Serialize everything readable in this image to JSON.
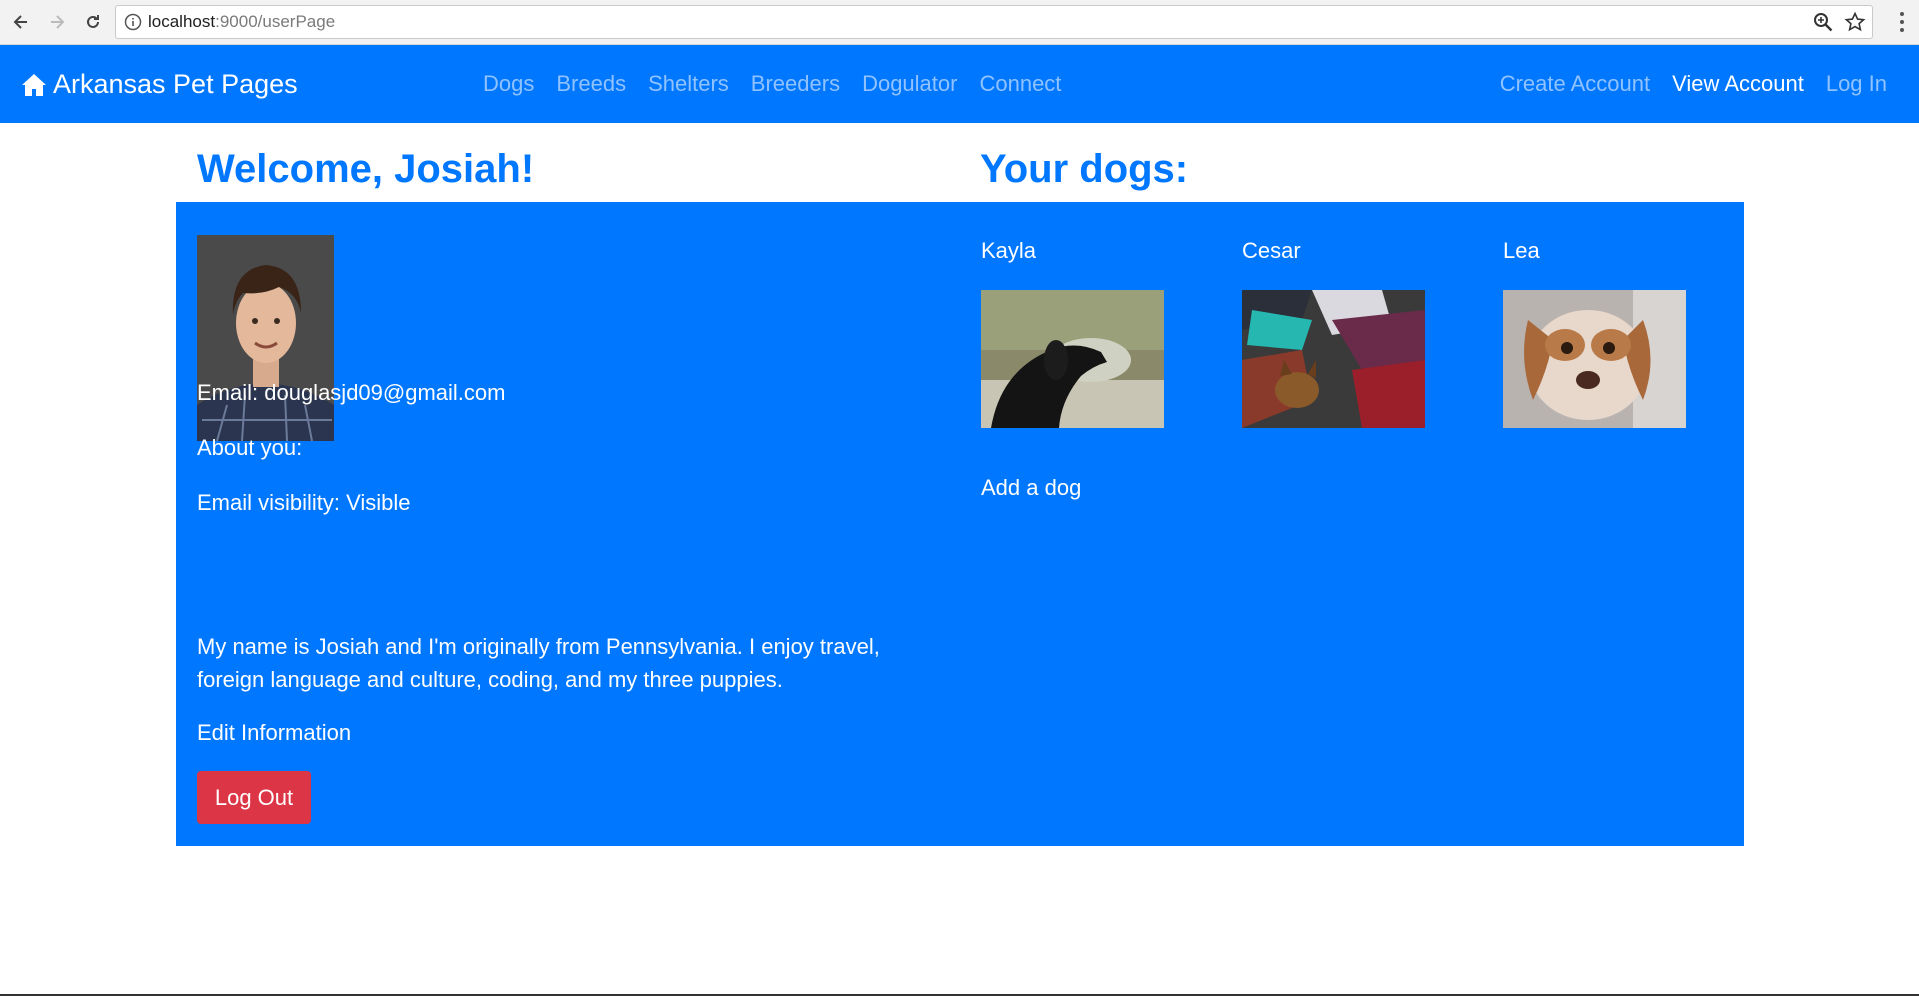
{
  "browser": {
    "url_host": "localhost",
    "url_path": ":9000/userPage"
  },
  "navbar": {
    "brand": "Arkansas Pet Pages",
    "links": [
      "Dogs",
      "Breeds",
      "Shelters",
      "Breeders",
      "Dogulator",
      "Connect"
    ],
    "right_links": [
      "Create Account",
      "View Account",
      "Log In"
    ]
  },
  "profile": {
    "welcome": "Welcome, Josiah!",
    "email": "Email: douglasjd09@gmail.com",
    "about_label": "About you:",
    "email_visibility": "Email visibility: Visible",
    "bio": "My name is Josiah and I'm originally from Pennsylvania. I enjoy travel, foreign language and culture, coding, and my three puppies.",
    "edit_label": "Edit Information",
    "logout_label": "Log Out"
  },
  "dogs": {
    "heading": "Your dogs:",
    "items": [
      {
        "name": "Kayla"
      },
      {
        "name": "Cesar"
      },
      {
        "name": "Lea"
      }
    ],
    "add_label": "Add a dog"
  },
  "colors": {
    "primary": "#0077ff",
    "nav_link": "#8fc2ff",
    "danger": "#dc3545"
  }
}
